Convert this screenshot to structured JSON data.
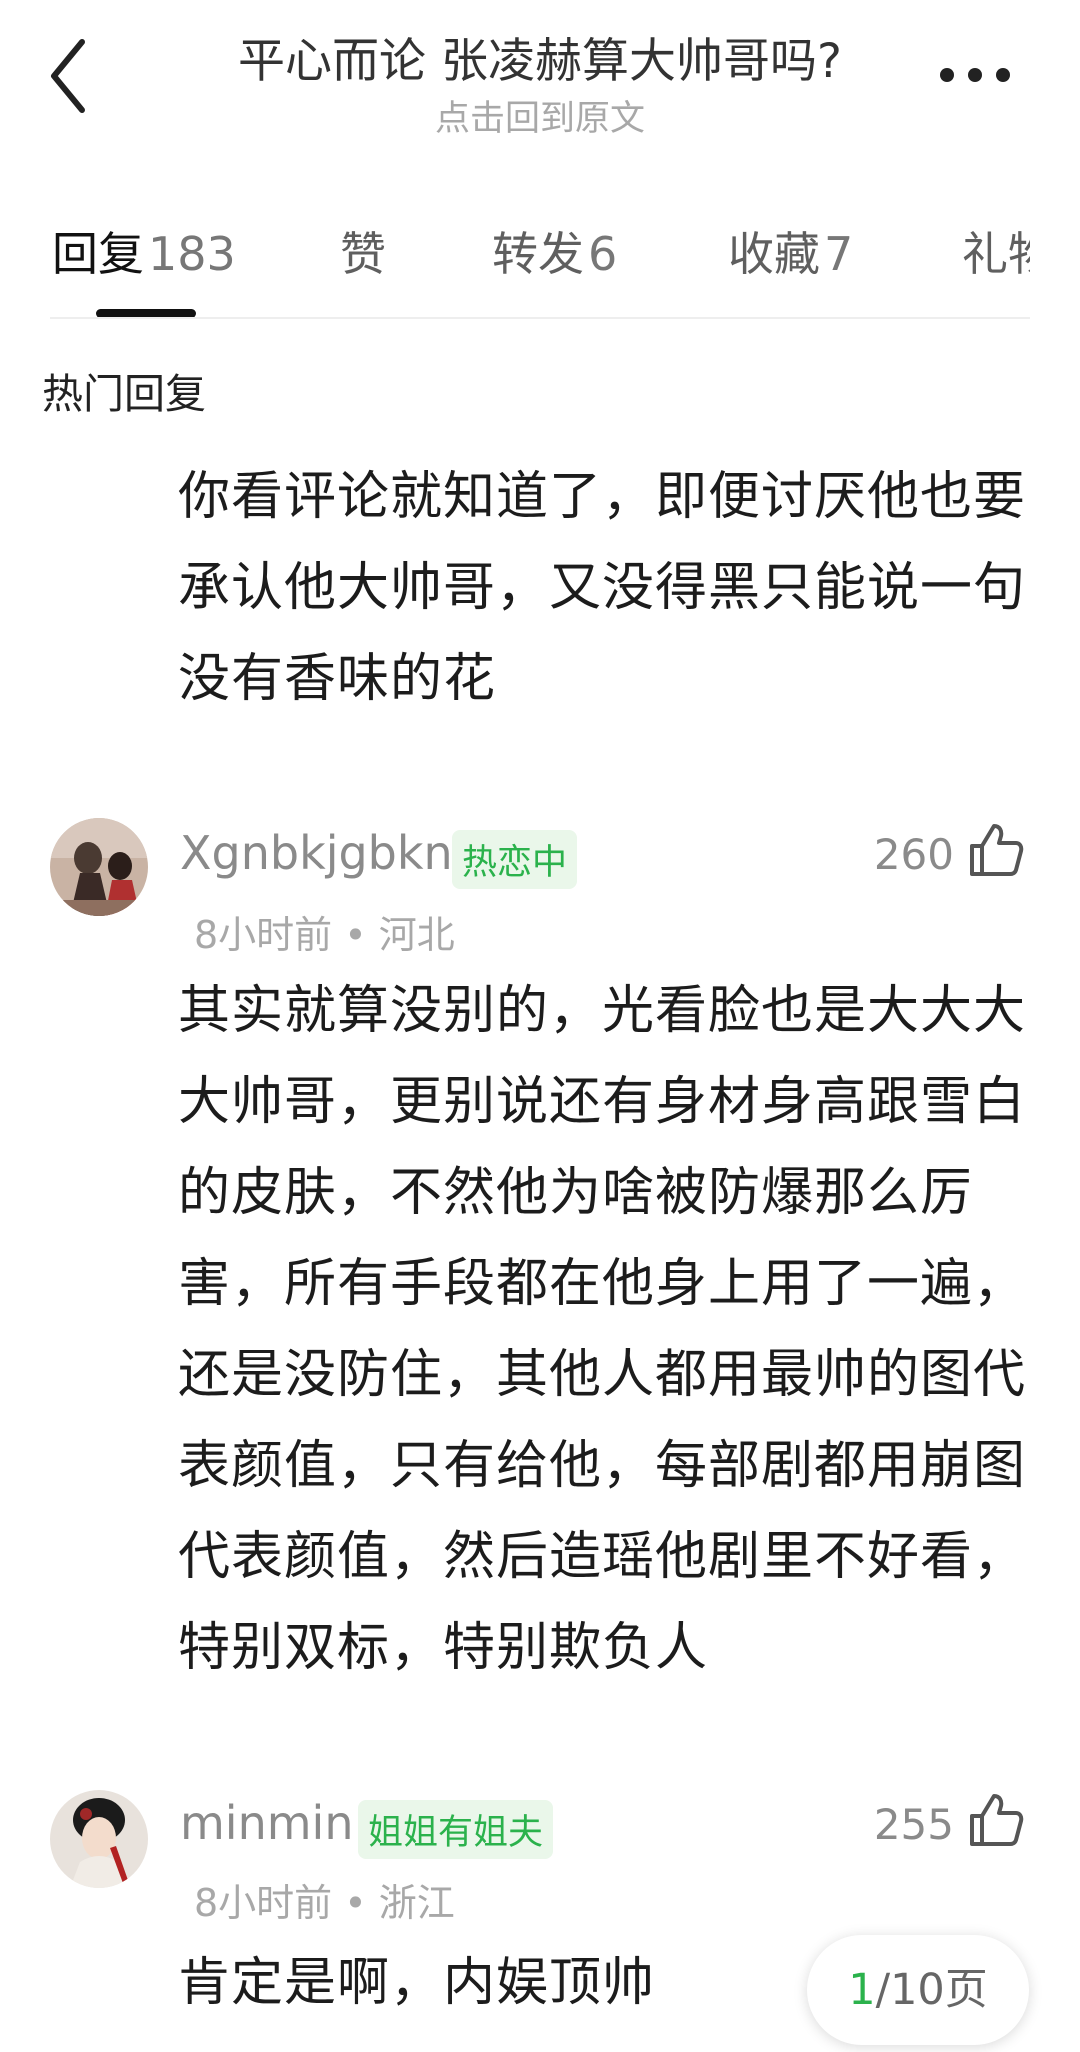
{
  "header": {
    "title": "平心而论 张凌赫算大帅哥吗?",
    "subtitle": "点击回到原文",
    "back_icon": "chevron-left-icon",
    "more_icon": "more-dots-icon"
  },
  "tabs": [
    {
      "label": "回复",
      "count": "183",
      "active": true
    },
    {
      "label": "赞",
      "count": ""
    },
    {
      "label": "转发",
      "count": "6"
    },
    {
      "label": "收藏",
      "count": "7"
    },
    {
      "label": "礼物",
      "count": ""
    }
  ],
  "section_title": "热门回复",
  "first_reply_text": "你看评论就知道了，即便讨厌他也要承认他大帅哥，又没得黑只能说一句没有香味的花",
  "comments": [
    {
      "username": "Xgnbkjgbkn",
      "badge": "热恋中",
      "likes": "260",
      "meta": "8小时前 • 河北",
      "text": "其实就算没别的，光看脸也是大大大大帅哥，更别说还有身材身高跟雪白的皮肤，不然他为啥被防爆那么厉害，所有手段都在他身上用了一遍，还是没防住，其他人都用最帅的图代表颜值，只有给他，每部剧都用崩图代表颜值，然后造瑶他剧里不好看，特别双标，特别欺负人"
    },
    {
      "username": "minmin",
      "badge": "姐姐有姐夫",
      "likes": "255",
      "meta": "8小时前 • 浙江",
      "text": "肯定是啊，内娱顶帅"
    }
  ],
  "pager": {
    "current": "1",
    "total": "/10页"
  },
  "colors": {
    "accent_green": "#2bb24c",
    "badge_bg": "#eaf7ea",
    "muted": "#a8a8a8"
  }
}
